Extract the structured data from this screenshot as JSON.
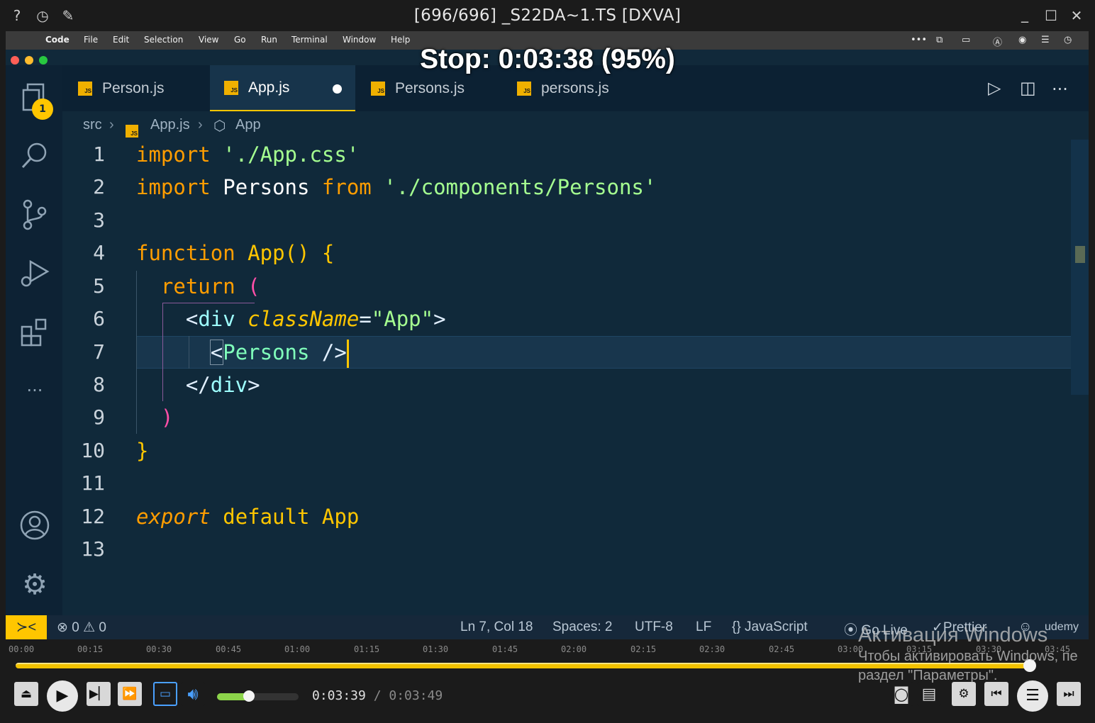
{
  "player": {
    "title": "[696/696] _S22DA~1.TS [DXVA]",
    "osd": "Stop: 0:03:38 (95%)",
    "current_time": "0:03:39",
    "sep": " / ",
    "total_time": "0:03:49",
    "progress_fraction": 0.95,
    "volume_fraction": 0.39,
    "timeline_ticks": [
      "00:00",
      "00:15",
      "00:30",
      "00:45",
      "01:00",
      "01:15",
      "01:30",
      "01:45",
      "02:00",
      "02:15",
      "02:30",
      "02:45",
      "03:00",
      "03:15",
      "03:30",
      "03:45"
    ]
  },
  "menubar": {
    "app": "Code",
    "items": [
      "File",
      "Edit",
      "Selection",
      "View",
      "Go",
      "Run",
      "Terminal",
      "Window",
      "Help"
    ]
  },
  "tabs": [
    {
      "label": "Person.js",
      "active": false
    },
    {
      "label": "App.js",
      "active": true,
      "modified": true
    },
    {
      "label": "Persons.js",
      "active": false
    },
    {
      "label": "persons.js",
      "active": false
    }
  ],
  "badge": "1",
  "breadcrumb": {
    "folder": "src",
    "file": "App.js",
    "symbol": "App"
  },
  "line_numbers": [
    "1",
    "2",
    "3",
    "4",
    "5",
    "6",
    "7",
    "8",
    "9",
    "10",
    "11",
    "12",
    "13"
  ],
  "code": {
    "l1_kw": "import",
    "l1_str": "'./App.css'",
    "l2_kw": "import",
    "l2_id": "Persons",
    "l2_from": "from",
    "l2_str": "'./components/Persons'",
    "l4_kw": "function",
    "l4_fn": "App",
    "l4_rest": "() {",
    "l5_kw": "return",
    "l5_par": "(",
    "l6_open": "<",
    "l6_tag": "div",
    "l6_attr": "className",
    "l6_eq": "=",
    "l6_str": "\"App\"",
    "l6_close": ">",
    "l7_open": "<",
    "l7_cmp": "Persons",
    "l7_close": " />",
    "l8_open": "</",
    "l8_tag": "div",
    "l8_close": ">",
    "l9_par": ")",
    "l10_brc": "}",
    "l12_exp": "export",
    "l12_def": "default",
    "l12_id": "App"
  },
  "status": {
    "errors": "0",
    "warnings": "0",
    "position": "Ln 7, Col 18",
    "spaces": "Spaces: 2",
    "encoding": "UTF-8",
    "eol": "LF",
    "language": "JavaScript",
    "golive": "Go Live",
    "prettier": "Prettier",
    "watermark": "udemy"
  },
  "windows_activation": {
    "title": "Активация Windows",
    "line1": "Чтобы активировать Windows, пе",
    "line2": "раздел \"Параметры\"."
  },
  "colors": {
    "accent": "#ffc600",
    "editor_bg": "#10293a",
    "tab_bar": "#0c2133",
    "seek": "#f2c200"
  }
}
